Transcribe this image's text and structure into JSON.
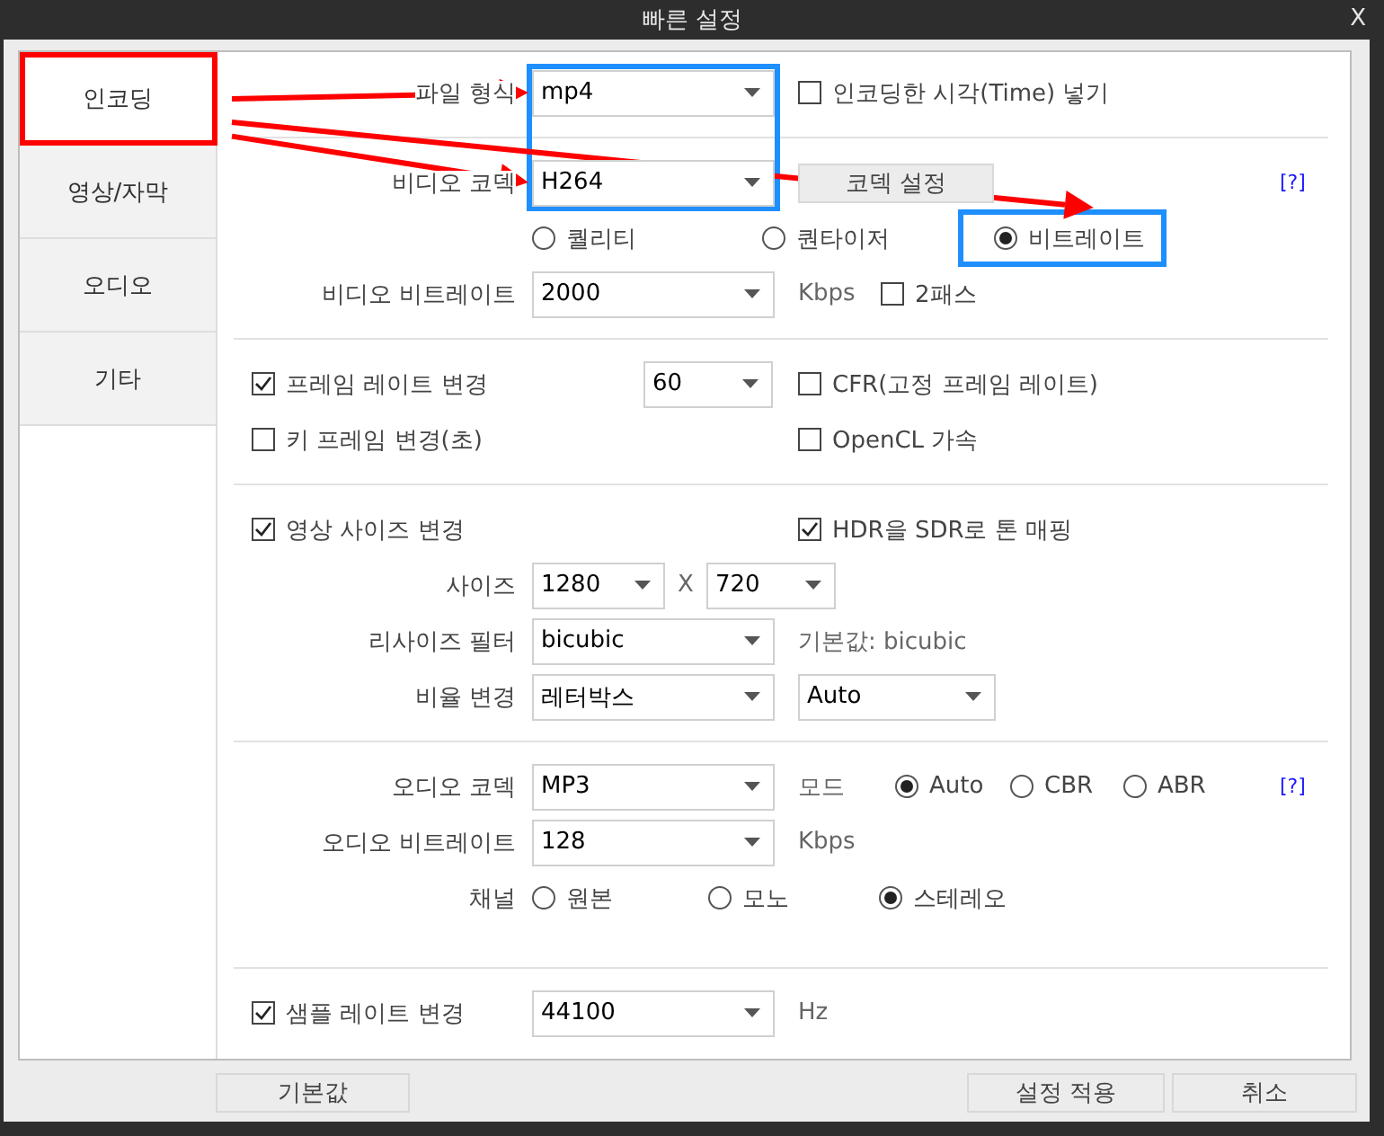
{
  "window": {
    "title": "빠른 설정",
    "close": "X"
  },
  "sidebar": {
    "items": [
      {
        "label": "인코딩",
        "selected": true,
        "highlight": {
          "color": "#ff0000"
        }
      },
      {
        "label": "영상/자막",
        "selected": false
      },
      {
        "label": "오디오",
        "selected": false
      },
      {
        "label": "기타",
        "selected": false
      }
    ]
  },
  "sections": [
    {
      "rows": [
        {
          "label": "파일 형식",
          "items": [
            {
              "kind": "select",
              "value": "mp4",
              "highlight": {
                "color": "#1e8fff"
              },
              "arrow": true
            },
            {
              "kind": "checkbox",
              "label": "인코딩한 시각(Time) 넣기",
              "checked": false
            }
          ]
        }
      ]
    },
    {
      "rows": [
        {
          "label": "비디오 코덱",
          "items": [
            {
              "kind": "select",
              "value": "H264",
              "highlight": {
                "color": "#1e8fff"
              },
              "arrow": true
            },
            {
              "kind": "button",
              "label": "코덱 설정"
            },
            {
              "kind": "link",
              "label": "[?]"
            }
          ]
        },
        {
          "items": [
            {
              "kind": "radio",
              "label": "퀄리티",
              "selected": false
            },
            {
              "kind": "radio",
              "label": "퀀타이저",
              "selected": false
            },
            {
              "kind": "radio",
              "label": "비트레이트",
              "selected": true,
              "highlight": {
                "color": "#1e8fff"
              },
              "arrow": true
            }
          ]
        },
        {
          "label": "비디오 비트레이트",
          "items": [
            {
              "kind": "select",
              "value": "2000"
            },
            {
              "kind": "text",
              "label": "Kbps"
            },
            {
              "kind": "checkbox",
              "label": "2패스",
              "checked": false
            }
          ]
        }
      ]
    },
    {
      "rows": [
        {
          "items": [
            {
              "kind": "checkbox",
              "label": "프레임 레이트 변경",
              "checked": true
            },
            {
              "kind": "select",
              "value": "60"
            },
            {
              "kind": "checkbox",
              "label": "CFR(고정 프레임 레이트)",
              "checked": false
            }
          ]
        },
        {
          "items": [
            {
              "kind": "checkbox",
              "label": "키 프레임 변경(초)",
              "checked": false
            },
            {
              "kind": "checkbox",
              "label": "OpenCL 가속",
              "checked": false
            }
          ]
        }
      ]
    },
    {
      "rows": [
        {
          "items": [
            {
              "kind": "checkbox",
              "label": "영상 사이즈 변경",
              "checked": true
            },
            {
              "kind": "checkbox",
              "label": "HDR을 SDR로 톤 매핑",
              "checked": true
            }
          ]
        },
        {
          "label": "사이즈",
          "items": [
            {
              "kind": "select",
              "value": "1280"
            },
            {
              "kind": "text",
              "label": "X"
            },
            {
              "kind": "select",
              "value": "720"
            }
          ]
        },
        {
          "label": "리사이즈 필터",
          "items": [
            {
              "kind": "select",
              "value": "bicubic"
            },
            {
              "kind": "text",
              "label": "기본값: bicubic"
            }
          ]
        },
        {
          "label": "비율 변경",
          "items": [
            {
              "kind": "select",
              "value": "레터박스"
            },
            {
              "kind": "select",
              "value": "Auto"
            }
          ]
        }
      ]
    },
    {
      "rows": [
        {
          "label": "오디오 코덱",
          "items": [
            {
              "kind": "select",
              "value": "MP3"
            },
            {
              "kind": "text",
              "label": "모드"
            },
            {
              "kind": "radio",
              "label": "Auto",
              "selected": true
            },
            {
              "kind": "radio",
              "label": "CBR",
              "selected": false
            },
            {
              "kind": "radio",
              "label": "ABR",
              "selected": false
            },
            {
              "kind": "link",
              "label": "[?]"
            }
          ]
        },
        {
          "label": "오디오 비트레이트",
          "items": [
            {
              "kind": "select",
              "value": "128"
            },
            {
              "kind": "text",
              "label": "Kbps"
            }
          ]
        },
        {
          "label": "채널",
          "items": [
            {
              "kind": "radio",
              "label": "원본",
              "selected": false
            },
            {
              "kind": "radio",
              "label": "모노",
              "selected": false
            },
            {
              "kind": "radio",
              "label": "스테레오",
              "selected": true
            }
          ]
        }
      ]
    },
    {
      "rows": [
        {
          "items": [
            {
              "kind": "checkbox",
              "label": "샘플 레이트 변경",
              "checked": true
            },
            {
              "kind": "select",
              "value": "44100"
            },
            {
              "kind": "text",
              "label": "Hz"
            }
          ]
        }
      ]
    }
  ],
  "footer": {
    "buttons": [
      "기본값",
      "설정 적용",
      "취소"
    ]
  }
}
